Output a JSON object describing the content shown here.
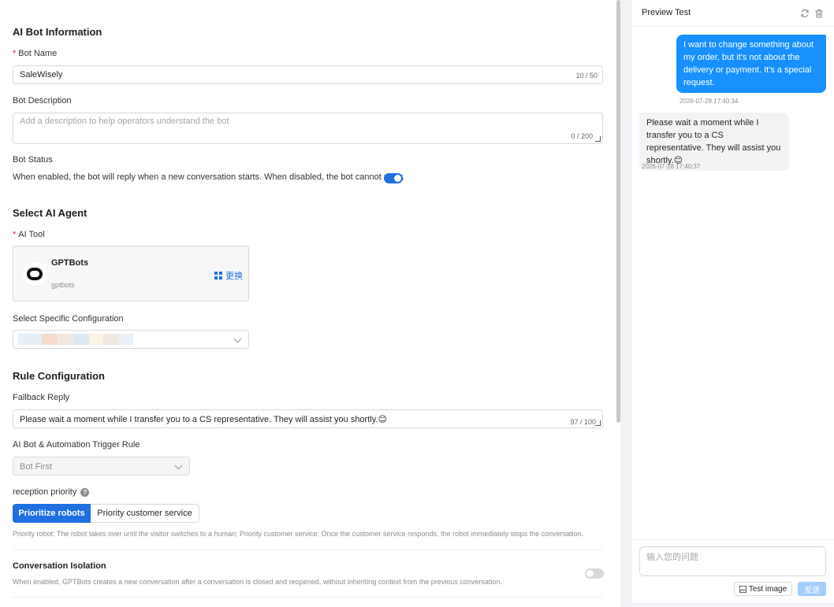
{
  "bot_info": {
    "section_title": "AI Bot Information",
    "name_label": "Bot Name",
    "name_value": "SaleWisely",
    "name_counter": "10 / 50",
    "description_label": "Bot Description",
    "description_placeholder": "Add a description to help operators understand the bot",
    "description_counter": "0 / 200",
    "status_label": "Bot Status",
    "status_desc": "When enabled, the bot will reply when a new conversation starts. When disabled, the bot cannot reply.",
    "status_enabled": true
  },
  "agent": {
    "section_title": "Select AI Agent",
    "tool_label": "AI Tool",
    "tool_name": "GPTBots",
    "tool_sub": "gptbots",
    "change_label": "更换",
    "config_label": "Select Specific Configuration"
  },
  "rules": {
    "section_title": "Rule Configuration",
    "fallback_label": "Fallback Reply",
    "fallback_value": "Please wait a moment while I transfer you to a CS representative. They will assist you shortly.😊",
    "fallback_counter": "97 / 100",
    "trigger_label": "AI Bot & Automation Trigger Rule",
    "trigger_value": "Bot First",
    "priority_label": "reception priority",
    "priority_options": [
      "Prioritize robots",
      "Priority customer service"
    ],
    "priority_selected": 0,
    "priority_hint": "Priority robot: The robot takes over until the visitor switches to a human; Priority customer service: Once the customer service responds, the robot immediately stops the conversation.",
    "isolation_title": "Conversation Isolation",
    "isolation_desc": "When enabled, GPTBots creates a new conversation after a conversation is closed and reopened, without inheriting context from the previous conversation.",
    "isolation_enabled": false
  },
  "preview": {
    "title": "Preview Test",
    "messages": [
      {
        "role": "user",
        "text": "I want to change something about my order, but it's not about the delivery or payment. It's a special request.",
        "time": "2026-07-28 17:40:34"
      },
      {
        "role": "bot",
        "text": "Please wait a moment while I transfer you to a CS representative. They will assist you shortly.😊",
        "time": "2026-07-28 17:40:37"
      }
    ],
    "input_placeholder": "输入您的问题",
    "test_image_label": "Test image",
    "send_label": "发送"
  },
  "colors": {
    "primary": "#1f6fe0",
    "user_bubble": "#1890ff",
    "bot_bubble": "#f2f3f5",
    "send_disabled": "#a3cdfa"
  },
  "icons": [
    "refresh-icon",
    "trash-icon",
    "grid-icon",
    "help-icon",
    "image-icon",
    "chevron-down-icon"
  ]
}
